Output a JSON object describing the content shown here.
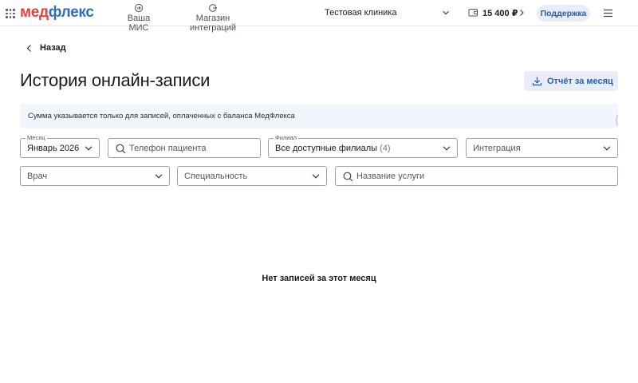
{
  "header": {
    "logo_part1": "мед",
    "logo_part2": "флекс",
    "nav": [
      {
        "label": "Ваша МИС",
        "icon": "login-icon"
      },
      {
        "label": "Магазин интеграций",
        "icon": "integrations-icon"
      }
    ],
    "clinic": "Тестовая клиника",
    "balance": "15 400 ₽",
    "support_label": "Поддержка"
  },
  "back_label": "Назад",
  "page_title": "История онлайн-записи",
  "report_button": "Отчёт за месяц",
  "banner_text": "Сумма указывается только для записей, оплаченных с баланса МедФлекса",
  "filters": {
    "month": {
      "label": "Месяц",
      "value": "Январь 2026"
    },
    "phone": {
      "placeholder": "Телефон пациента"
    },
    "branch": {
      "label": "Филиал",
      "value": "Все доступные филиалы",
      "count": "(4)"
    },
    "integration": {
      "placeholder": "Интеграция"
    },
    "doctor": {
      "placeholder": "Врач"
    },
    "specialty": {
      "placeholder": "Специальность"
    },
    "service": {
      "placeholder": "Название услуги"
    }
  },
  "empty_message": "Нет записей за этот месяц",
  "colors": {
    "accent": "#2c5ea8",
    "accent_bg": "#e7eef9",
    "logo_red": "#e8403f",
    "logo_blue": "#2e6ec2",
    "banner_bg": "#f2f6fc"
  }
}
